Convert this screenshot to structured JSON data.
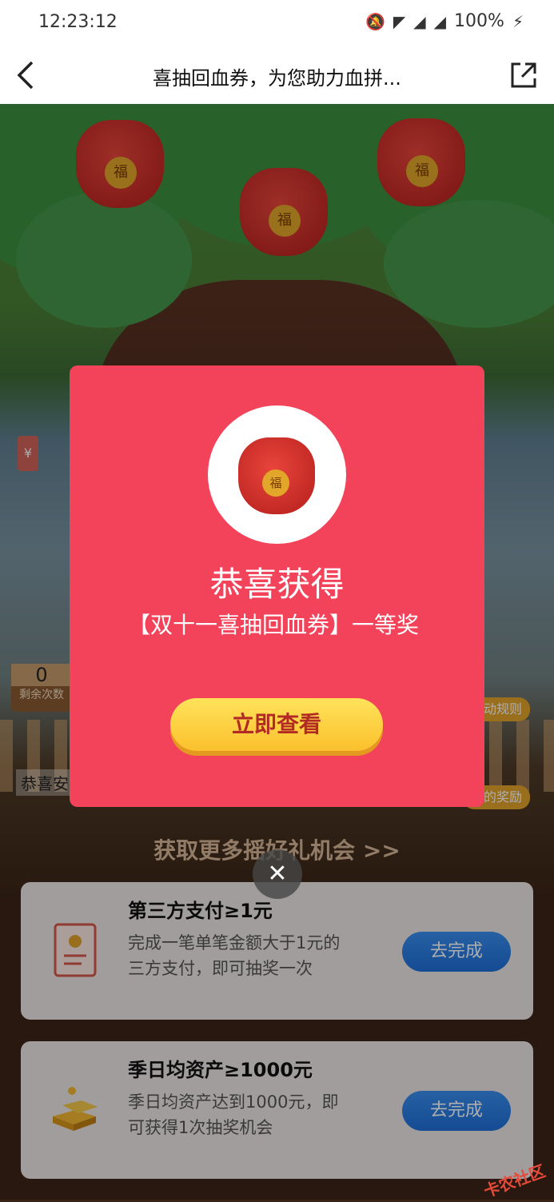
{
  "status": {
    "time": "12:23:12",
    "battery": "100%"
  },
  "navbar": {
    "title": "喜抽回血券，为您助力血拼..."
  },
  "tree": {
    "bag_label": "福",
    "coin_symbol": "¥"
  },
  "side": {
    "count_num": "0",
    "count_label": "剩余次数",
    "rules_label": "活动规则",
    "rewards_label": "我的奖励",
    "ticker": "恭喜安..."
  },
  "modal": {
    "heading": "恭喜获得",
    "prize": "【双十一喜抽回血券】一等奖",
    "cta": "立即查看"
  },
  "tasks": {
    "header": "获取更多摇好礼机会 >>",
    "items": [
      {
        "title": "第三方支付≥1元",
        "desc": "完成一笔单笔金额大于1元的三方支付，即可抽奖一次",
        "action": "去完成"
      },
      {
        "title": "季日均资产≥1000元",
        "desc": "季日均资产达到1000元，即可获得1次抽奖机会",
        "action": "去完成"
      }
    ]
  },
  "watermark": "卡农社区"
}
